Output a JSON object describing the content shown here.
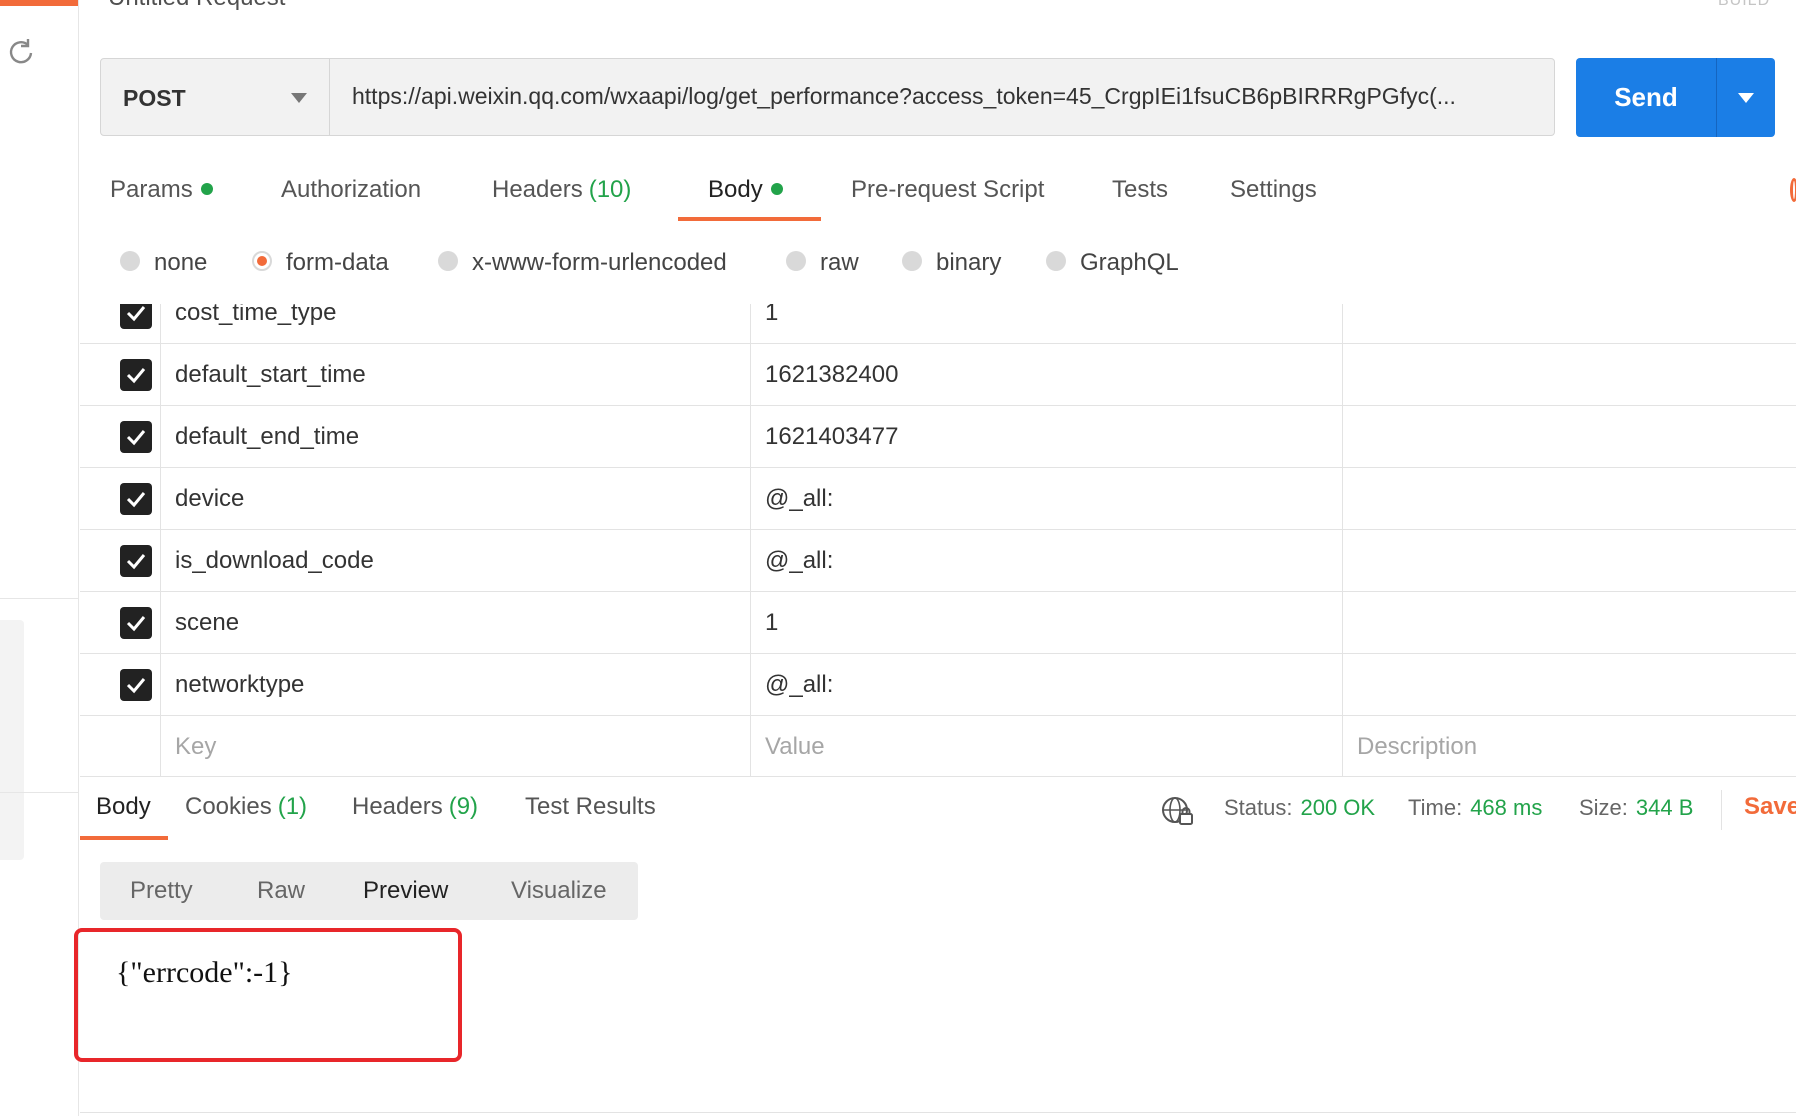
{
  "request": {
    "title": "Untitled Request",
    "build_label": "BUILD",
    "method": "POST",
    "url": "https://api.weixin.qq.com/wxaapi/log/get_performance?access_token=45_CrgpIEi1fsuCB6pBIRRRgPGfyc(...",
    "send_label": "Send"
  },
  "request_tabs": {
    "params": "Params",
    "authorization": "Authorization",
    "headers": "Headers",
    "headers_count": "(10)",
    "body": "Body",
    "pre_request": "Pre-request Script",
    "tests": "Tests",
    "settings": "Settings"
  },
  "body_types": {
    "none": "none",
    "form_data": "form-data",
    "urlencoded": "x-www-form-urlencoded",
    "raw": "raw",
    "binary": "binary",
    "graphql": "GraphQL",
    "selected": "form-data"
  },
  "form_rows": [
    {
      "key": "cost_time_type",
      "value": "1",
      "checked": true
    },
    {
      "key": "default_start_time",
      "value": "1621382400",
      "checked": true
    },
    {
      "key": "default_end_time",
      "value": "1621403477",
      "checked": true
    },
    {
      "key": "device",
      "value": "@_all:",
      "checked": true
    },
    {
      "key": "is_download_code",
      "value": "@_all:",
      "checked": true
    },
    {
      "key": "scene",
      "value": "1",
      "checked": true
    },
    {
      "key": "networktype",
      "value": "@_all:",
      "checked": true
    }
  ],
  "form_placeholders": {
    "key": "Key",
    "value": "Value",
    "description": "Description"
  },
  "response_tabs": {
    "body": "Body",
    "cookies": "Cookies",
    "cookies_count": "(1)",
    "headers": "Headers",
    "headers_count": "(9)",
    "test_results": "Test Results"
  },
  "response_status": {
    "status_label": "Status:",
    "status_value": "200 OK",
    "time_label": "Time:",
    "time_value": "468 ms",
    "size_label": "Size:",
    "size_value": "344 B",
    "save_label": "Save"
  },
  "view_modes": {
    "pretty": "Pretty",
    "raw": "Raw",
    "preview": "Preview",
    "visualize": "Visualize",
    "selected": "Preview"
  },
  "response_body": "{\"errcode\":-1}",
  "colors": {
    "accent": "#f26b3a",
    "primary": "#1b7ee6",
    "success": "#22a34a",
    "highlight": "#e8262a"
  }
}
